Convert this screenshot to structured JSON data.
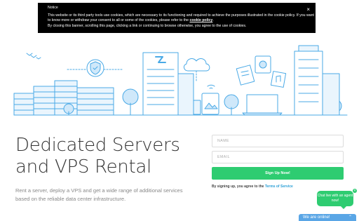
{
  "cookie": {
    "title": "Notice",
    "text": "This website or its third party tools use cookies, which are necessary to its functioning and required to achieve the purposes illustrated in the cookie policy. If you want to know more or withdraw your consent to all or some of the cookies, please refer to the",
    "link": "cookie policy",
    "text_after": ".",
    "text2": "By closing this banner, scrolling this page, clicking a link or continuing to browse otherwise, you agree to the use of cookies.",
    "close": "×"
  },
  "hero": {
    "title": "Dedicated Servers and VPS Rental",
    "subtitle": "Rent a server, deploy a VPS and get a wide range of additional services based on the reliable data center infrastructure."
  },
  "form": {
    "name_placeholder": "NAME",
    "email_placeholder": "EMAIL",
    "submit_label": "Sign Up Now!",
    "terms_text": "By signing up, you agree to the ",
    "terms_link": "Terms of Service"
  },
  "chat": {
    "bubble": "Chat live with an agent now!",
    "close": "×",
    "bar": "We are online!",
    "bar_icon": "chevron-up-icon"
  },
  "colors": {
    "accent_green": "#2ecc71",
    "illustration_blue": "#49a9e6",
    "chat_blue": "#5aa6e6"
  }
}
